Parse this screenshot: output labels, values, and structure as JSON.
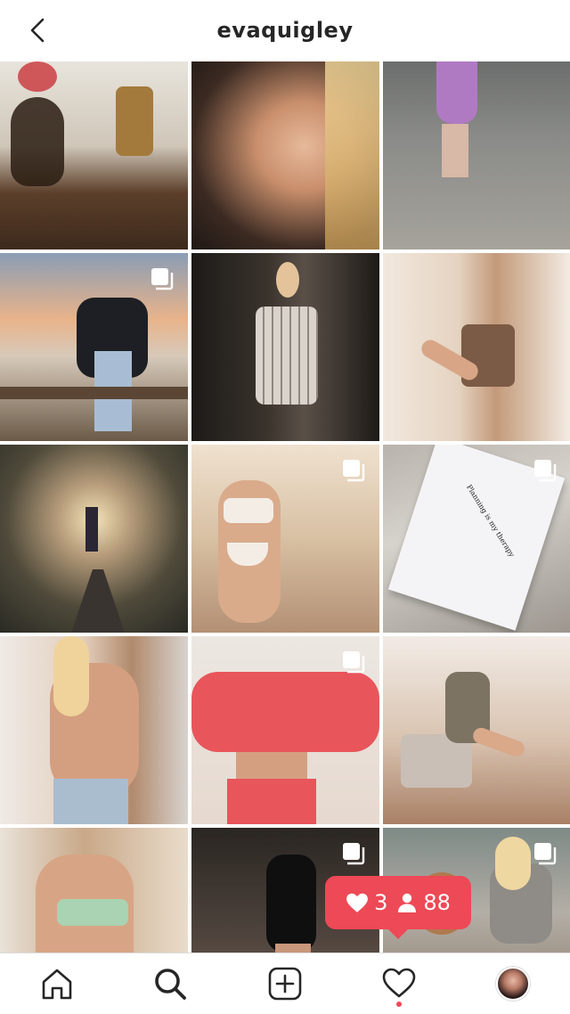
{
  "header": {
    "username": "evaquigley",
    "back_icon": "chevron-left-icon"
  },
  "grid": {
    "posts": [
      {
        "index": 0,
        "multi": false
      },
      {
        "index": 1,
        "multi": false
      },
      {
        "index": 2,
        "multi": false
      },
      {
        "index": 3,
        "multi": true
      },
      {
        "index": 4,
        "multi": false
      },
      {
        "index": 5,
        "multi": false
      },
      {
        "index": 6,
        "multi": false
      },
      {
        "index": 7,
        "multi": true
      },
      {
        "index": 8,
        "multi": true
      },
      {
        "index": 9,
        "multi": false
      },
      {
        "index": 10,
        "multi": true
      },
      {
        "index": 11,
        "multi": false
      },
      {
        "index": 12,
        "multi": false
      },
      {
        "index": 13,
        "multi": true
      },
      {
        "index": 14,
        "multi": true
      }
    ],
    "book_text": "Planning is my therapy"
  },
  "notification": {
    "likes": "3",
    "followers": "88",
    "color": "#ed4956"
  },
  "tabbar": {
    "items": [
      "home-icon",
      "search-icon",
      "new-post-icon",
      "activity-icon",
      "profile-avatar"
    ],
    "badge_color": "#ed4956"
  }
}
